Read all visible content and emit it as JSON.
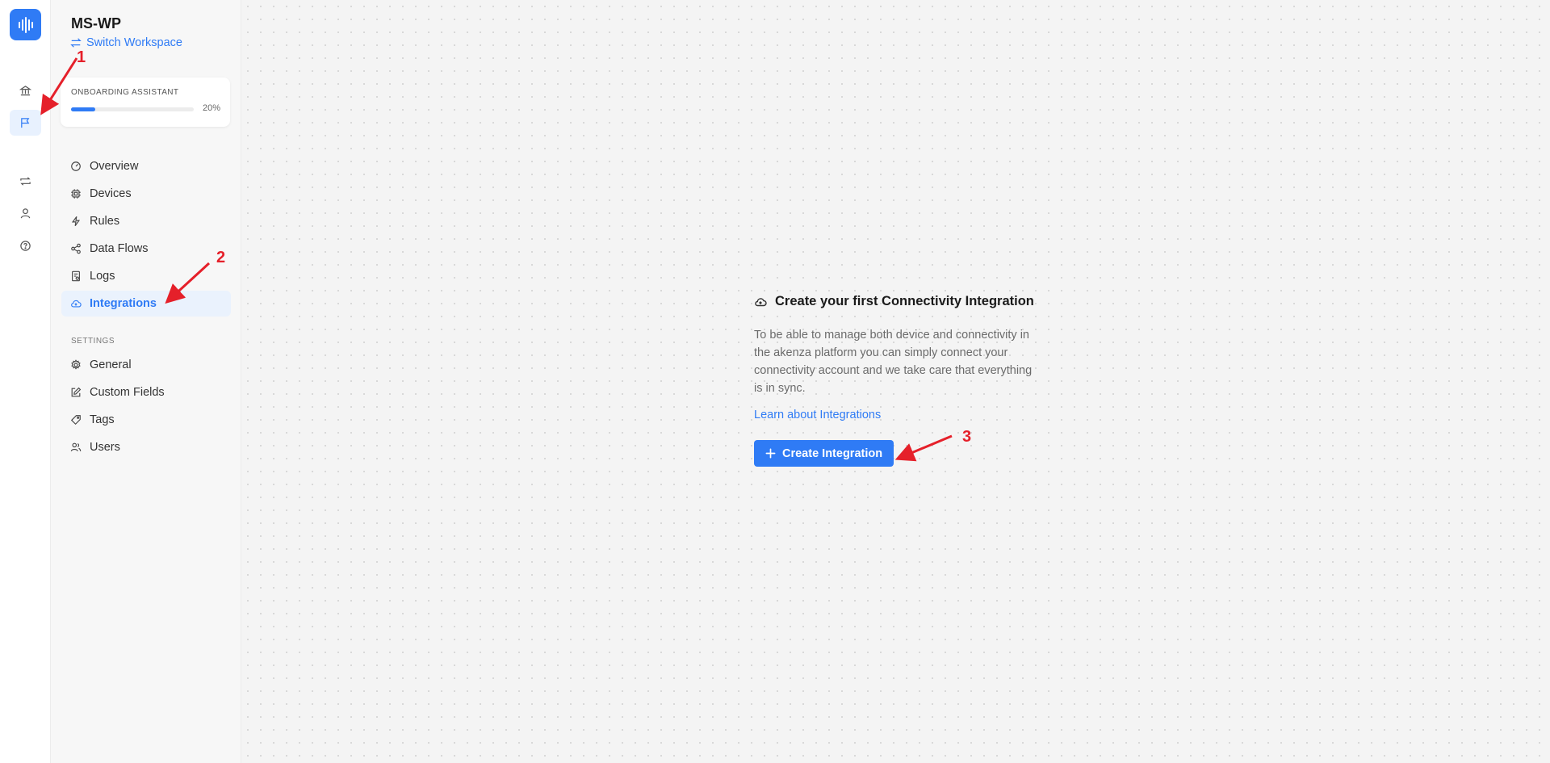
{
  "workspace": {
    "name": "MS-WP",
    "switch_label": "Switch Workspace"
  },
  "rail": {
    "icons": [
      "logo-icon",
      "bank-icon",
      "flag-icon",
      "repeat-icon",
      "user-icon",
      "help-icon"
    ]
  },
  "onboarding": {
    "label": "ONBOARDING ASSISTANT",
    "progress": 0.2,
    "progress_label": "20%"
  },
  "nav": {
    "items": [
      {
        "label": "Overview",
        "icon": "gauge-icon"
      },
      {
        "label": "Devices",
        "icon": "chip-icon"
      },
      {
        "label": "Rules",
        "icon": "bolt-icon"
      },
      {
        "label": "Data Flows",
        "icon": "share-icon"
      },
      {
        "label": "Logs",
        "icon": "log-icon"
      },
      {
        "label": "Integrations",
        "icon": "cloud-icon",
        "active": true
      }
    ],
    "settings_label": "SETTINGS",
    "settings_items": [
      {
        "label": "General",
        "icon": "gear-icon"
      },
      {
        "label": "Custom Fields",
        "icon": "edit-icon"
      },
      {
        "label": "Tags",
        "icon": "tag-icon"
      },
      {
        "label": "Users",
        "icon": "users-icon"
      }
    ]
  },
  "empty_state": {
    "title": "Create your first Connectivity Integration",
    "description": "To be able to manage both device and connectivity in the akenza platform you can simply connect your connectivity account and we take care that everything is in sync.",
    "learn_link": "Learn about Integrations",
    "cta_label": "Create Integration"
  },
  "annotations": {
    "labels": [
      "1",
      "2",
      "3"
    ],
    "color": "#e5202a"
  },
  "colors": {
    "accent": "#2f7bf5",
    "active_bg": "#eaf2fd"
  }
}
